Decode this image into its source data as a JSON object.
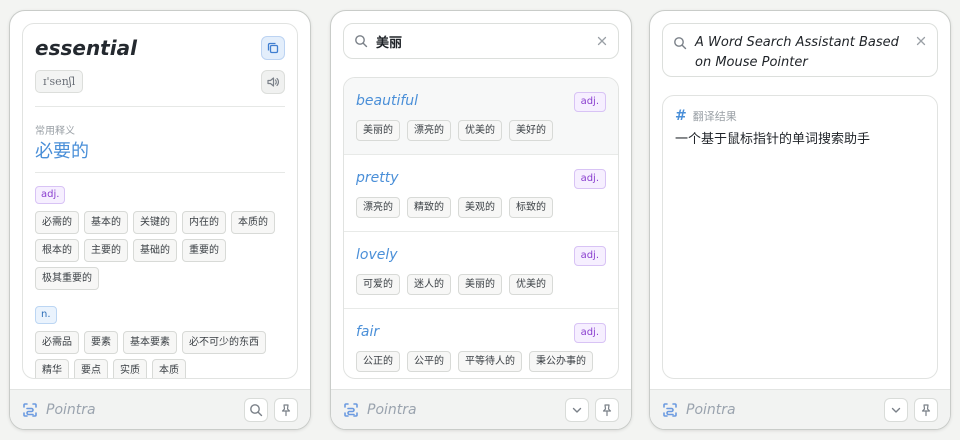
{
  "brand": {
    "name": "Pointra"
  },
  "panel1": {
    "word": "essential",
    "phonetic": "ɪ'senʃl",
    "section_label": "常用释义",
    "meaning": "必要的",
    "adj": {
      "pos": "adj.",
      "tags": [
        "必需的",
        "基本的",
        "关键的",
        "内在的",
        "本质的",
        "根本的",
        "主要的",
        "基础的",
        "重要的",
        "极其重要的"
      ]
    },
    "n": {
      "pos": "n.",
      "tags": [
        "必需品",
        "要素",
        "基本要素",
        "必不可少的东西",
        "精华",
        "要点",
        "实质",
        "本质"
      ]
    }
  },
  "panel2": {
    "query": "美丽",
    "results": [
      {
        "word": "beautiful",
        "pos": "adj.",
        "tags": [
          "美丽的",
          "漂亮的",
          "优美的",
          "美好的"
        ]
      },
      {
        "word": "pretty",
        "pos": "adj.",
        "tags": [
          "漂亮的",
          "精致的",
          "美观的",
          "标致的"
        ]
      },
      {
        "word": "lovely",
        "pos": "adj.",
        "tags": [
          "可爱的",
          "迷人的",
          "美丽的",
          "优美的"
        ]
      },
      {
        "word": "fair",
        "pos": "adj.",
        "tags": [
          "公正的",
          "公平的",
          "平等待人的",
          "秉公办事的"
        ]
      }
    ]
  },
  "panel3": {
    "query": "A Word Search Assistant Based on Mouse Pointer",
    "result_label": "翻译结果",
    "result_text": "一个基于鼠标指针的单词搜索助手"
  },
  "colors": {
    "accent": "#4a8fd8",
    "adj": "#8a3fcf",
    "noun": "#2f6fb8"
  },
  "icons": [
    "copy-icon",
    "speaker-icon",
    "search-icon",
    "close-icon",
    "chevron-down-icon",
    "pin-icon",
    "pointra-logo-icon",
    "hash-icon"
  ]
}
